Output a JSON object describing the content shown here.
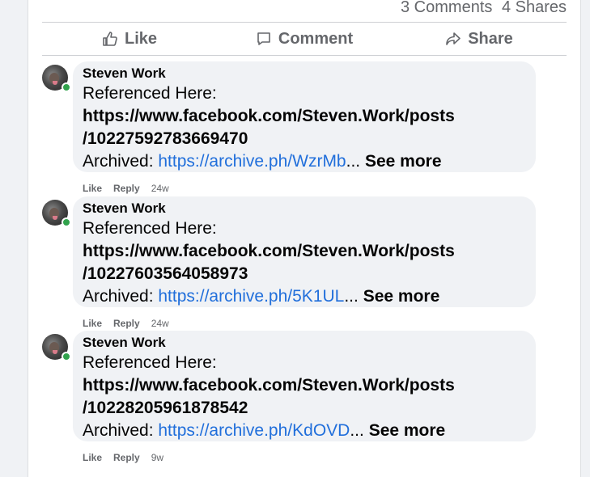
{
  "stats": {
    "comments": "3 Comments",
    "shares": "4 Shares"
  },
  "actions": {
    "like": "Like",
    "comment": "Comment",
    "share": "Share"
  },
  "comments": [
    {
      "author": "Steven Work",
      "intro": "Referenced Here:",
      "url_line1": "https://www.facebook.com/Steven.Work/posts",
      "url_line2": "/10227592783669470",
      "archived_label": "Archived: ",
      "archived_link": "https://archive.ph/WzrMb",
      "ellipsis": "...",
      "see_more": "See more",
      "like": "Like",
      "reply": "Reply",
      "time": "24w"
    },
    {
      "author": "Steven Work",
      "intro": "Referenced Here:",
      "url_line1": "https://www.facebook.com/Steven.Work/posts",
      "url_line2": "/10227603564058973",
      "archived_label": "Archived: ",
      "archived_link": "https://archive.ph/5K1UL",
      "ellipsis": "...",
      "see_more": "See more",
      "like": "Like",
      "reply": "Reply",
      "time": "24w"
    },
    {
      "author": "Steven Work",
      "intro": "Referenced Here:",
      "url_line1": "https://www.facebook.com/Steven.Work/posts",
      "url_line2": "/10228205961878542",
      "archived_label": "Archived: ",
      "archived_link": "https://archive.ph/KdOVD",
      "ellipsis": "...",
      "see_more": "See more",
      "like": "Like",
      "reply": "Reply",
      "time": "9w"
    }
  ],
  "colors": {
    "link": "#216fdb",
    "online": "#31a24c",
    "muted": "#65676b"
  }
}
